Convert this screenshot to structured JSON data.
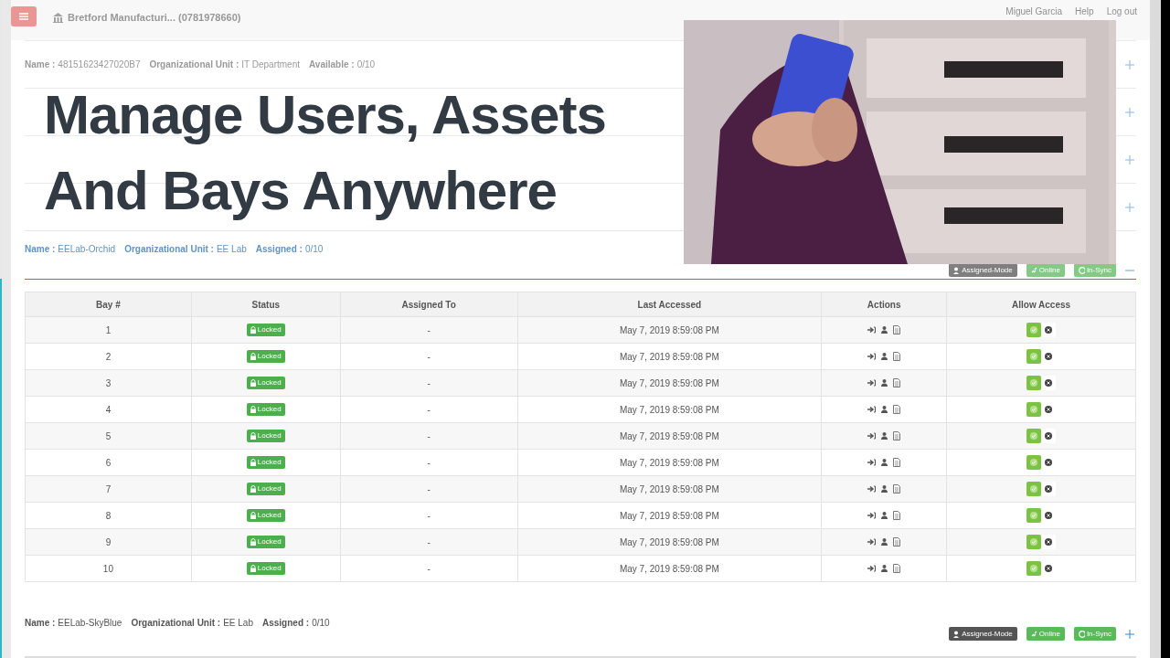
{
  "header": {
    "company": "Bretford Manufacturi... (0781978660)",
    "user": "Miguel Garcia",
    "help": "Help",
    "logout": "Log out"
  },
  "headline": [
    "Manage Users, Assets",
    "And Bays Anywhere"
  ],
  "background_groups": [
    {
      "fields": [
        {
          "label": "Name :",
          "value": "48151623427020B7"
        },
        {
          "label": "Organizational Unit :",
          "value": "IT Department"
        },
        {
          "label": "Available :",
          "value": "0/10"
        }
      ],
      "expanded": false
    },
    {
      "expanded": false
    },
    {
      "expanded": false
    },
    {
      "expanded": false
    }
  ],
  "active_group": {
    "fields": [
      {
        "label": "Name :",
        "value": "EELab-Orchid"
      },
      {
        "label": "Organizational Unit :",
        "value": "EE Lab"
      },
      {
        "label": "Assigned :",
        "value": "0/10"
      }
    ],
    "badges": [
      {
        "kind": "mode",
        "label": "Assigned-Mode"
      },
      {
        "kind": "online",
        "label": "Online"
      },
      {
        "kind": "sync",
        "label": "In-Sync"
      }
    ],
    "expanded": true
  },
  "table": {
    "columns": [
      "Bay #",
      "Status",
      "Assigned To",
      "Last Accessed",
      "Actions",
      "Allow Access"
    ],
    "rows": [
      {
        "bay": "1",
        "status": "Locked",
        "assigned_to": "-",
        "last_accessed": "May 7, 2019 8:59:08 PM",
        "allowed": true
      },
      {
        "bay": "2",
        "status": "Locked",
        "assigned_to": "-",
        "last_accessed": "May 7, 2019 8:59:08 PM",
        "allowed": true
      },
      {
        "bay": "3",
        "status": "Locked",
        "assigned_to": "-",
        "last_accessed": "May 7, 2019 8:59:08 PM",
        "allowed": true
      },
      {
        "bay": "4",
        "status": "Locked",
        "assigned_to": "-",
        "last_accessed": "May 7, 2019 8:59:08 PM",
        "allowed": true
      },
      {
        "bay": "5",
        "status": "Locked",
        "assigned_to": "-",
        "last_accessed": "May 7, 2019 8:59:08 PM",
        "allowed": true
      },
      {
        "bay": "6",
        "status": "Locked",
        "assigned_to": "-",
        "last_accessed": "May 7, 2019 8:59:08 PM",
        "allowed": true
      },
      {
        "bay": "7",
        "status": "Locked",
        "assigned_to": "-",
        "last_accessed": "May 7, 2019 8:59:08 PM",
        "allowed": true
      },
      {
        "bay": "8",
        "status": "Locked",
        "assigned_to": "-",
        "last_accessed": "May 7, 2019 8:59:08 PM",
        "allowed": true
      },
      {
        "bay": "9",
        "status": "Locked",
        "assigned_to": "-",
        "last_accessed": "May 7, 2019 8:59:08 PM",
        "allowed": true
      },
      {
        "bay": "10",
        "status": "Locked",
        "assigned_to": "-",
        "last_accessed": "May 7, 2019 8:59:08 PM",
        "allowed": true
      }
    ]
  },
  "next_group": {
    "fields": [
      {
        "label": "Name :",
        "value": "EELab-SkyBlue"
      },
      {
        "label": "Organizational Unit :",
        "value": "EE Lab"
      },
      {
        "label": "Assigned :",
        "value": "0/10"
      }
    ],
    "badges": [
      {
        "kind": "mode",
        "label": "Assigned-Mode"
      },
      {
        "kind": "online",
        "label": "Online"
      },
      {
        "kind": "sync",
        "label": "In-Sync"
      }
    ],
    "expanded": false
  }
}
